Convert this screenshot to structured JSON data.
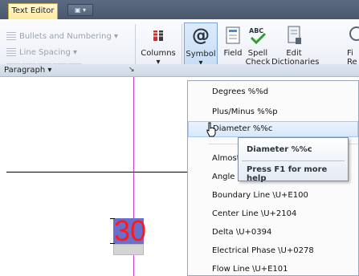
{
  "tabs": {
    "text_editor": "Text Editor",
    "mini_tab": "▣ ▾"
  },
  "paragraph": {
    "bullets_label": "Bullets and Numbering ▾",
    "line_spacing_label": "Line Spacing ▾",
    "group_label": "Paragraph ▾",
    "launcher": "↘"
  },
  "ribbon": {
    "columns_label": "Columns",
    "columns_arrow": "▾",
    "symbol_label": "Symbol",
    "symbol_arrow": "▾",
    "symbol_glyph": "@",
    "field_label": "Field",
    "spell_line1": "Spell",
    "spell_line2": "Check",
    "spell_glyph": "ABC",
    "edit_line1": "Edit",
    "edit_line2": "Dictionaries",
    "cut_line1": "Fi",
    "cut_line2": "Re"
  },
  "document": {
    "mtext_value": "30"
  },
  "menu": {
    "items": [
      "Degrees  %%d",
      "Plus/Minus  %%p",
      "Diameter  %%c",
      "Almost",
      "Angle",
      "Boundary Line  \\U+E100",
      "Center Line  \\U+2104",
      "Delta  \\U+0394",
      "Electrical Phase  \\U+0278",
      "Flow Line  \\U+E101"
    ]
  },
  "tooltip": {
    "title": "Diameter  %%c",
    "help": "Press F1 for more help"
  },
  "colors": {
    "accent": "#6a6fcc",
    "text_red": "#ff1a1a",
    "guide": "#cc3bd0"
  }
}
